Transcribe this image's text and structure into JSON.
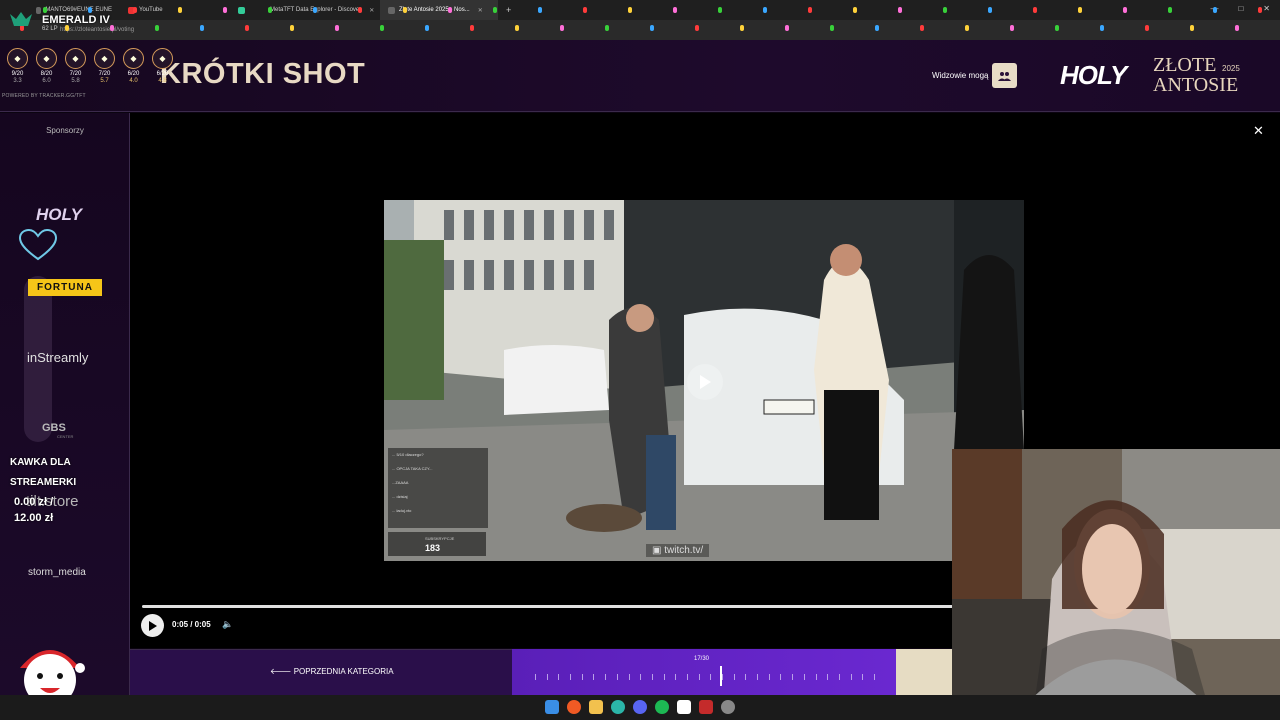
{
  "browser": {
    "tabs": [
      {
        "label": "MANTO69#EUNE EUNE",
        "active": false
      },
      {
        "label": "YouTube",
        "active": false
      },
      {
        "label": "",
        "active": false
      },
      {
        "label": "MetaTFT Data Explorer - Discover",
        "active": false
      },
      {
        "label": "Złote Antosie 2025 - Nos...",
        "active": true
      }
    ],
    "url": "https://zloteantosie.pl/voting"
  },
  "tracker": {
    "rank": "EMERALD IV",
    "rank_sub": "62 LP",
    "items": [
      {
        "top": "9/20",
        "sub": "3.3"
      },
      {
        "top": "8/20",
        "sub": "6.0"
      },
      {
        "top": "7/20",
        "sub": "5.8"
      },
      {
        "top": "7/20",
        "sub": "5.7"
      },
      {
        "top": "6/20",
        "sub": "4.0"
      },
      {
        "top": "6/20",
        "sub": "4.8"
      }
    ],
    "powered": "POWERED BY TRACKER.GG/TFT"
  },
  "header": {
    "title": "KRÓTKI SHOT",
    "viewers_label": "Widzowie mogą",
    "logo_holy": "HOLY",
    "logo_zlote": "ZŁOTE",
    "logo_antosie": "ANTOSIE",
    "logo_year": "2025"
  },
  "sidebar": {
    "title": "Sponsorzy",
    "holy": "HOLY",
    "fortuna": "FORTUNA",
    "instreamly": "inStreamly",
    "gbs": "GBS",
    "gbs_sub": "CENTER",
    "tiltstore": "tilt.store",
    "storm": "storm_media",
    "kawka_line1": "KAWKA DLA",
    "kawka_line2": "STREAMERKI",
    "kawka_current": "0.00 zł /",
    "kawka_goal": "12.00 zł"
  },
  "video": {
    "twitch": "twitch.tv/",
    "sub_label": "SUBSKRYPCJE",
    "sub_count": "183",
    "chat_lines": [
      "... 5/10 dlaczego?",
      "... OPCJA TAKA CZY...",
      "...ZAAAA",
      "... dzisiaj",
      "... ładuj.vto"
    ],
    "time": "0:05 / 0:05"
  },
  "category_bar": {
    "prev_label": "POPRZEDNIA KATEGORIA",
    "count": "17/30",
    "current_index": 17,
    "total": 30
  },
  "icons": {
    "close": "close-icon",
    "play": "play-icon",
    "volume": "volume-icon",
    "viewers": "people-icon",
    "heart": "heart-icon",
    "arrow_left": "arrow-left-icon"
  },
  "colors": {
    "accent_purple": "#6a28d0",
    "header_bg": "#1e0a2c",
    "gold": "#e7d6bd",
    "fortuna": "#f5c518"
  }
}
